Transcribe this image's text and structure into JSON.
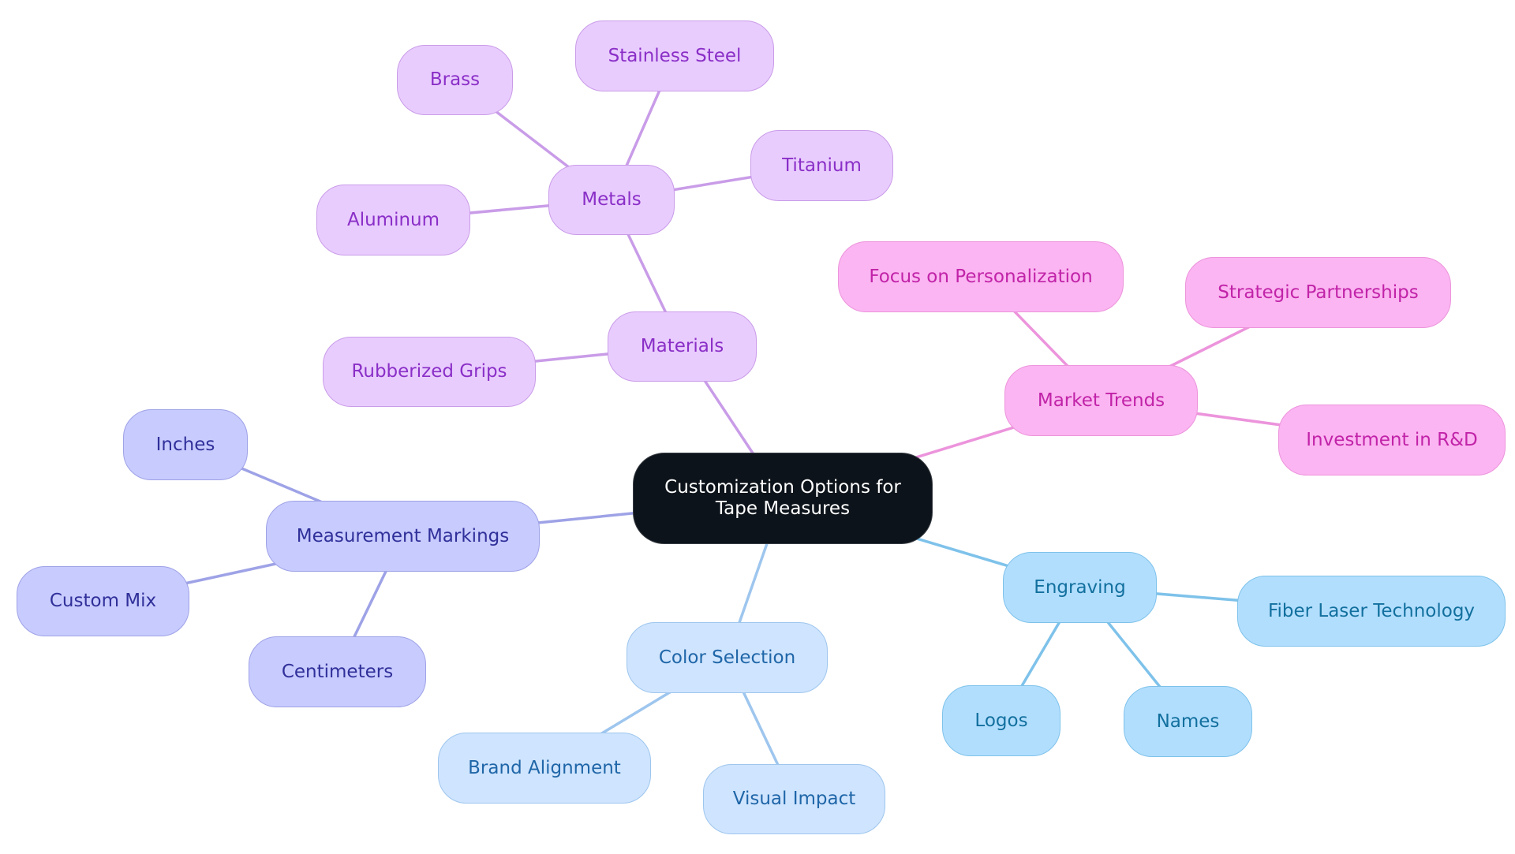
{
  "diagram": {
    "type": "mindmap",
    "root": {
      "id": "root",
      "label": "Customization Options for Tape Measures"
    },
    "colors": {
      "purple": {
        "edge": "#c99ce8"
      },
      "pink": {
        "edge": "#ec94dc"
      },
      "indigo": {
        "edge": "#9ea2e6"
      },
      "lightblue": {
        "edge": "#9ec6ee"
      },
      "sky": {
        "edge": "#7ec2ea"
      }
    },
    "nodes": [
      {
        "id": "materials",
        "label": "Materials",
        "parent": "root",
        "color": "purple"
      },
      {
        "id": "metals",
        "label": "Metals",
        "parent": "materials",
        "color": "purple"
      },
      {
        "id": "brass",
        "label": "Brass",
        "parent": "metals",
        "color": "purple"
      },
      {
        "id": "stainless",
        "label": "Stainless Steel",
        "parent": "metals",
        "color": "purple"
      },
      {
        "id": "titanium",
        "label": "Titanium",
        "parent": "metals",
        "color": "purple"
      },
      {
        "id": "aluminum",
        "label": "Aluminum",
        "parent": "metals",
        "color": "purple"
      },
      {
        "id": "rubber",
        "label": "Rubberized Grips",
        "parent": "materials",
        "color": "purple"
      },
      {
        "id": "market",
        "label": "Market Trends",
        "parent": "root",
        "color": "pink"
      },
      {
        "id": "focus",
        "label": "Focus on Personalization",
        "parent": "market",
        "color": "pink"
      },
      {
        "id": "strategic",
        "label": "Strategic Partnerships",
        "parent": "market",
        "color": "pink"
      },
      {
        "id": "invest",
        "label": "Investment in R&D",
        "parent": "market",
        "color": "pink"
      },
      {
        "id": "markings",
        "label": "Measurement Markings",
        "parent": "root",
        "color": "indigo"
      },
      {
        "id": "inches",
        "label": "Inches",
        "parent": "markings",
        "color": "indigo"
      },
      {
        "id": "custommix",
        "label": "Custom Mix",
        "parent": "markings",
        "color": "indigo"
      },
      {
        "id": "cm",
        "label": "Centimeters",
        "parent": "markings",
        "color": "indigo"
      },
      {
        "id": "colorsel",
        "label": "Color Selection",
        "parent": "root",
        "color": "lightblue"
      },
      {
        "id": "brand",
        "label": "Brand Alignment",
        "parent": "colorsel",
        "color": "lightblue"
      },
      {
        "id": "visual",
        "label": "Visual Impact",
        "parent": "colorsel",
        "color": "lightblue"
      },
      {
        "id": "engraving",
        "label": "Engraving",
        "parent": "root",
        "color": "sky"
      },
      {
        "id": "fiber",
        "label": "Fiber Laser Technology",
        "parent": "engraving",
        "color": "sky"
      },
      {
        "id": "logos",
        "label": "Logos",
        "parent": "engraving",
        "color": "sky"
      },
      {
        "id": "names",
        "label": "Names",
        "parent": "engraving",
        "color": "sky"
      }
    ]
  }
}
